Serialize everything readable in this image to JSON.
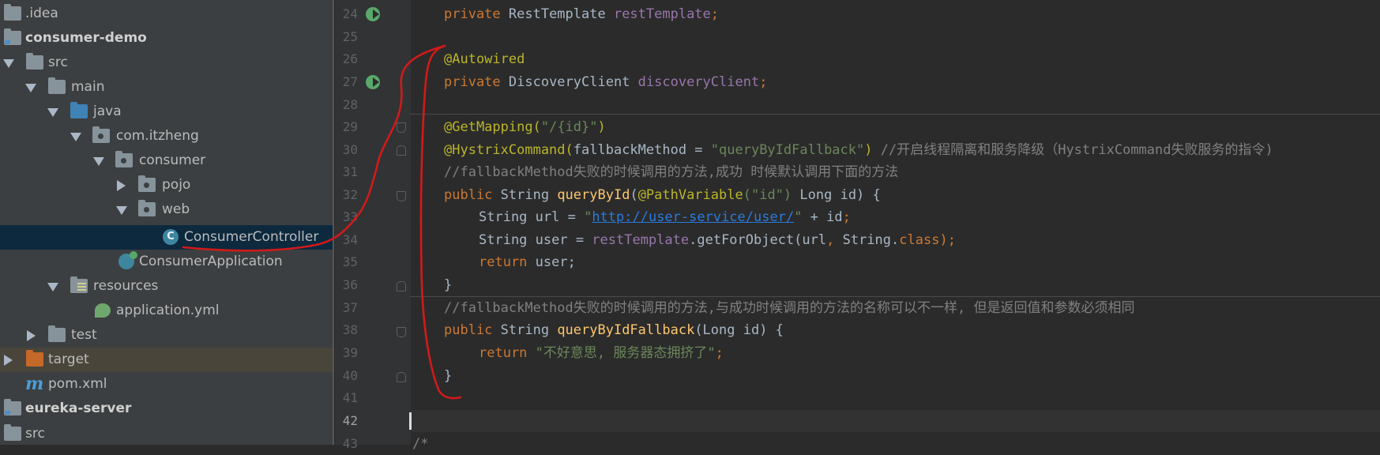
{
  "project_tree": {
    "items": [
      {
        "label": ".idea",
        "icon": "folder-icon"
      },
      {
        "label": "consumer-demo",
        "icon": "module-folder-icon"
      },
      {
        "label": "src",
        "icon": "folder-icon"
      },
      {
        "label": "main",
        "icon": "folder-icon"
      },
      {
        "label": "java",
        "icon": "source-folder-icon"
      },
      {
        "label": "com.itzheng",
        "icon": "package-icon"
      },
      {
        "label": "consumer",
        "icon": "package-icon"
      },
      {
        "label": "pojo",
        "icon": "package-icon"
      },
      {
        "label": "web",
        "icon": "package-icon"
      },
      {
        "label": "ConsumerController",
        "icon": "class-icon",
        "badge": "C"
      },
      {
        "label": "ConsumerApplication",
        "icon": "spring-boot-app-icon"
      },
      {
        "label": "resources",
        "icon": "resources-folder-icon"
      },
      {
        "label": "application.yml",
        "icon": "spring-config-icon"
      },
      {
        "label": "test",
        "icon": "folder-icon"
      },
      {
        "label": "target",
        "icon": "excluded-folder-icon"
      },
      {
        "label": "pom.xml",
        "icon": "maven-icon",
        "badge": "m"
      },
      {
        "label": "eureka-server",
        "icon": "module-folder-icon"
      },
      {
        "label": "src",
        "icon": "folder-icon"
      }
    ],
    "selected": "ConsumerController"
  },
  "editor": {
    "current_line": "42",
    "line_numbers": [
      "24",
      "25",
      "26",
      "27",
      "28",
      "29",
      "30",
      "31",
      "32",
      "33",
      "34",
      "35",
      "36",
      "37",
      "38",
      "39",
      "40",
      "41",
      "42",
      "43"
    ],
    "code": {
      "l24": {
        "kw": "private ",
        "type": "RestTemplate ",
        "field": "restTemplate",
        "end": ";"
      },
      "l26": {
        "ann": "@Autowired"
      },
      "l27": {
        "kw": "private ",
        "type": "DiscoveryClient ",
        "field": "discoveryClient",
        "end": ";"
      },
      "l29": {
        "ann": "@GetMapping",
        "open": "(",
        "str": "\"/{id}\"",
        "close": ")"
      },
      "l30": {
        "ann": "@HystrixCommand",
        "open": "(",
        "param": "fallbackMethod = ",
        "str": "\"queryByIdFallback\"",
        "close": ") ",
        "comment": "//开启线程隔离和服务降级（HystrixCommand失败服务的指令)"
      },
      "l31": {
        "comment": "//fallbackMethod失败的时候调用的方法,成功 时候默认调用下面的方法"
      },
      "l32": {
        "kw": "public ",
        "type": "String ",
        "method": "queryById",
        "open": "(",
        "ann": "@PathVariable",
        "str": "(\"id\")",
        "rest": " Long id) {"
      },
      "l33": {
        "type": "String url = ",
        "url": "http://user-service/user/",
        "quote1": "\"",
        "quote2": "\"",
        "rest": " + id",
        ";": ";"
      },
      "l34": {
        "type": "String user = ",
        "field": "restTemplate",
        "call": ".getForObject(url",
        "comma": ", ",
        "cls": "String.",
        "kw": "class",
        "end": ");"
      },
      "l35": {
        "kw": "return ",
        "rest": "user;"
      },
      "l36": {
        "rest": "}"
      },
      "l37": {
        "comment": "//fallbackMethod失败的时候调用的方法,与成功时候调用的方法的名称可以不一样, 但是返回值和参数必须相同"
      },
      "l38": {
        "kw": "public ",
        "type": "String ",
        "method": "queryByIdFallback",
        "rest": "(Long id) {"
      },
      "l39": {
        "kw": "return ",
        "str": "\"不好意思, 服务器态拥挤了\"",
        "end": ";"
      },
      "l40": {
        "rest": "}"
      },
      "l43": {
        "comment": "/*"
      }
    }
  },
  "colors": {
    "tree_bg": "#3c3f41",
    "editor_bg": "#2b2b2b",
    "gutter_bg": "#313335",
    "selection": "#0d293e",
    "keyword": "#cc7832",
    "annotation": "#bbb529",
    "string": "#6a8759",
    "comment": "#808080",
    "field": "#9876aa",
    "scribble": "#d11a1a"
  }
}
